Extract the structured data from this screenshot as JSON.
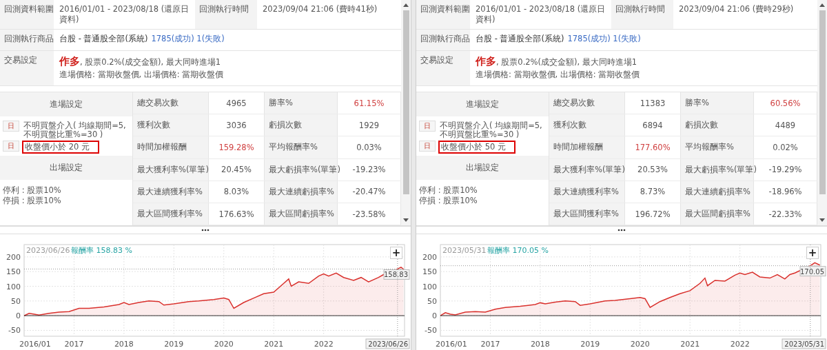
{
  "panels": [
    {
      "info": {
        "range_label": "回測資料範圍",
        "range_value": "2016/01/01 - 2023/08/18 (還原日資料)",
        "run_label": "回測執行時間",
        "run_value": "2023/09/04 21:06 (費時41秒)",
        "product_label": "回測執行商品",
        "product_value": "台股 - 普通股全部(系統)",
        "product_count": "1785(成功) 1(失敗)",
        "trade_label": "交易設定",
        "trade_direction": "作多",
        "trade_detail": ", 股票0.2%(成交金額), 最大同時進場1",
        "trade_prices": "進場價格: 當期收盤價, 出場價格: 當期收盤價"
      },
      "entry_title": "進場設定",
      "entries": [
        {
          "badge": "日",
          "text": "不明買盤介入( 均線期間=5, 不明買盤比重%=30 )",
          "boxed": false
        },
        {
          "badge": "日",
          "text": "收盤價小於 20 元",
          "boxed": true
        }
      ],
      "exit_title": "出場設定",
      "exits": [
        "停利 : 股票10%",
        "停損 : 股票10%"
      ],
      "stats": [
        {
          "label": "總交易次數",
          "value": "4965",
          "value_emphasis": false,
          "label2": "勝率%",
          "value2": "61.15%",
          "value2_emphasis": true
        },
        {
          "label": "獲利次數",
          "value": "3036",
          "value_emphasis": false,
          "label2": "虧損次數",
          "value2": "1929",
          "value2_emphasis": false
        },
        {
          "label": "時間加權報酬",
          "value": "159.28%",
          "value_emphasis": true,
          "label2": "平均報酬率%",
          "value2": "0.03%",
          "value2_emphasis": false
        },
        {
          "label": "最大獲利率%(單筆)",
          "value": "20.45%",
          "value_emphasis": false,
          "label2": "最大虧損率%(單筆)",
          "value2": "-19.23%",
          "value2_emphasis": false
        },
        {
          "label": "最大連續獲利率%",
          "value": "8.03%",
          "value_emphasis": false,
          "label2": "最大連續虧損率%",
          "value2": "-20.47%",
          "value2_emphasis": false
        },
        {
          "label": "最大區間獲利率%",
          "value": "176.63%",
          "value_emphasis": false,
          "label2": "最大區間虧損率%",
          "value2": "-23.58%",
          "value2_emphasis": false
        }
      ],
      "chart": {
        "tooltip_date": "2023/06/26",
        "tooltip_value": "158.83 %",
        "zoom_label": "+",
        "chart_data": {
          "type": "area",
          "grid": true,
          "xlim": [
            2016,
            2023.62
          ],
          "ylim": [
            -70,
            242
          ],
          "xticks": [
            {
              "value": 2016,
              "label": "2016/01"
            },
            {
              "value": 2017,
              "label": "2017"
            },
            {
              "value": 2018,
              "label": "2018"
            },
            {
              "value": 2019,
              "label": "2019"
            },
            {
              "value": 2020,
              "label": "2020"
            },
            {
              "value": 2021,
              "label": "2021"
            },
            {
              "value": 2022,
              "label": "2022"
            }
          ],
          "yticks": [
            -50,
            0,
            50,
            100,
            150,
            200
          ],
          "x": [
            2016,
            2016.1,
            2016.2,
            2016.3,
            2016.5,
            2016.7,
            2016.9,
            2017.1,
            2017.3,
            2017.6,
            2017.9,
            2018,
            2018.1,
            2018.3,
            2018.5,
            2018.7,
            2018.8,
            2019,
            2019.3,
            2019.5,
            2019.8,
            2020,
            2020.1,
            2020.2,
            2020.4,
            2020.6,
            2020.8,
            2021,
            2021.2,
            2021.3,
            2021.35,
            2021.5,
            2021.7,
            2021.9,
            2022,
            2022.1,
            2022.25,
            2022.4,
            2022.6,
            2022.75,
            2022.9,
            2023.1,
            2023.2,
            2023.48,
            2023.55,
            2023.6
          ],
          "series": [
            {
              "name": "報酬率",
              "color": "#d9302c",
              "values": [
                0,
                8,
                5,
                2,
                8,
                12,
                14,
                25,
                25,
                30,
                38,
                45,
                38,
                45,
                50,
                48,
                36,
                40,
                48,
                50,
                55,
                60,
                55,
                25,
                45,
                60,
                75,
                80,
                110,
                125,
                100,
                115,
                110,
                135,
                142,
                135,
                145,
                130,
                120,
                130,
                115,
                130,
                140,
                159,
                165,
                158
              ]
            }
          ],
          "ref_lines": [
            {
              "axis": "y",
              "value": 158.83,
              "label": "158.83"
            },
            {
              "axis": "x",
              "value": 2023.48,
              "label": "2023/06/26"
            }
          ]
        }
      }
    },
    {
      "info": {
        "range_label": "回測資料範圍",
        "range_value": "2016/01/01 - 2023/08/18 (還原日資料)",
        "run_label": "回測執行時間",
        "run_value": "2023/09/04 21:06 (費時29秒)",
        "product_label": "回測執行商品",
        "product_value": "台股 - 普通股全部(系統)",
        "product_count": "1785(成功) 1(失敗)",
        "trade_label": "交易設定",
        "trade_direction": "作多",
        "trade_detail": ", 股票0.2%(成交金額), 最大同時進場1",
        "trade_prices": "進場價格: 當期收盤價, 出場價格: 當期收盤價"
      },
      "entry_title": "進場設定",
      "entries": [
        {
          "badge": "日",
          "text": "不明買盤介入( 均線期間=5, 不明買盤比重%=30 )",
          "boxed": false
        },
        {
          "badge": "日",
          "text": "收盤價小於 50 元",
          "boxed": true
        }
      ],
      "exit_title": "出場設定",
      "exits": [
        "停利 : 股票10%",
        "停損 : 股票10%"
      ],
      "stats": [
        {
          "label": "總交易次數",
          "value": "11383",
          "value_emphasis": false,
          "label2": "勝率%",
          "value2": "60.56%",
          "value2_emphasis": true
        },
        {
          "label": "獲利次數",
          "value": "6894",
          "value_emphasis": false,
          "label2": "虧損次數",
          "value2": "4489",
          "value2_emphasis": false
        },
        {
          "label": "時間加權報酬",
          "value": "177.60%",
          "value_emphasis": true,
          "label2": "平均報酬率%",
          "value2": "0.02%",
          "value2_emphasis": false
        },
        {
          "label": "最大獲利率%(單筆)",
          "value": "20.53%",
          "value_emphasis": false,
          "label2": "最大虧損率%(單筆)",
          "value2": "-19.29%",
          "value2_emphasis": false
        },
        {
          "label": "最大連續獲利率%",
          "value": "8.73%",
          "value_emphasis": false,
          "label2": "最大連續虧損率%",
          "value2": "-18.96%",
          "value2_emphasis": false
        },
        {
          "label": "最大區間獲利率%",
          "value": "196.72%",
          "value_emphasis": false,
          "label2": "最大區間虧損率%",
          "value2": "-22.33%",
          "value2_emphasis": false
        }
      ],
      "chart": {
        "tooltip_date": "2023/05/31",
        "tooltip_value": "170.05 %",
        "zoom_label": "+",
        "chart_data": {
          "type": "area",
          "grid": true,
          "xlim": [
            2016,
            2023.62
          ],
          "ylim": [
            -70,
            242
          ],
          "xticks": [
            {
              "value": 2016,
              "label": "2016/01"
            },
            {
              "value": 2017,
              "label": "2017"
            },
            {
              "value": 2018,
              "label": "2018"
            },
            {
              "value": 2019,
              "label": "2019"
            },
            {
              "value": 2020,
              "label": "2020"
            },
            {
              "value": 2021,
              "label": "2021"
            },
            {
              "value": 2022,
              "label": "2022"
            }
          ],
          "yticks": [
            -50,
            0,
            50,
            100,
            150,
            200
          ],
          "x": [
            2016,
            2016.1,
            2016.2,
            2016.3,
            2016.5,
            2016.7,
            2016.9,
            2017.1,
            2017.3,
            2017.6,
            2017.9,
            2018,
            2018.1,
            2018.3,
            2018.5,
            2018.7,
            2018.8,
            2019,
            2019.3,
            2019.5,
            2019.8,
            2020,
            2020.1,
            2020.2,
            2020.4,
            2020.6,
            2020.8,
            2021,
            2021.2,
            2021.3,
            2021.35,
            2021.5,
            2021.7,
            2021.9,
            2022,
            2022.1,
            2022.25,
            2022.4,
            2022.6,
            2022.75,
            2022.9,
            2023,
            2023.1,
            2023.41,
            2023.5,
            2023.6
          ],
          "series": [
            {
              "name": "報酬率",
              "color": "#d9302c",
              "values": [
                0,
                10,
                5,
                3,
                12,
                14,
                12,
                22,
                28,
                32,
                38,
                44,
                40,
                46,
                50,
                48,
                35,
                40,
                50,
                52,
                58,
                62,
                58,
                28,
                48,
                62,
                75,
                85,
                110,
                128,
                102,
                120,
                118,
                138,
                145,
                140,
                148,
                132,
                128,
                140,
                125,
                140,
                145,
                170,
                180,
                172
              ]
            }
          ],
          "ref_lines": [
            {
              "axis": "y",
              "value": 170.05,
              "label": "170.05"
            },
            {
              "axis": "x",
              "value": 2023.41,
              "label": "2023/05/31"
            }
          ]
        }
      }
    }
  ]
}
